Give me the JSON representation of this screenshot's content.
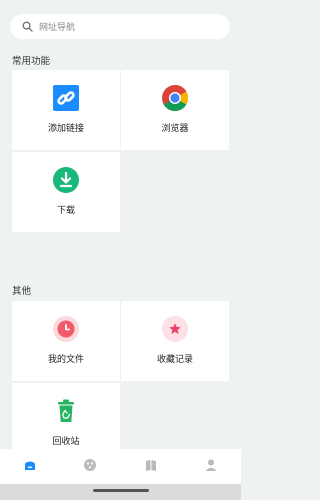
{
  "search": {
    "placeholder": "网址导航"
  },
  "sections": {
    "common": {
      "title": "常用功能",
      "items": [
        {
          "label": "添加链接",
          "icon": "link-icon"
        },
        {
          "label": "浏览器",
          "icon": "chrome-icon"
        },
        {
          "label": "下载",
          "icon": "download-icon"
        }
      ]
    },
    "other": {
      "title": "其他",
      "items": [
        {
          "label": "我的文件",
          "icon": "clock-icon"
        },
        {
          "label": "收藏记录",
          "icon": "star-icon"
        },
        {
          "label": "回收站",
          "icon": "recycle-bin-icon"
        }
      ]
    }
  },
  "bottom_nav": [
    {
      "icon": "home-icon",
      "active": true
    },
    {
      "icon": "discover-icon",
      "active": false
    },
    {
      "icon": "bookmark-icon",
      "active": false
    },
    {
      "icon": "profile-icon",
      "active": false
    }
  ],
  "colors": {
    "accent": "#1a8cff",
    "download": "#19b77b",
    "file": "#f05a6a",
    "star": "#e8456b",
    "recycle": "#27b35f"
  }
}
